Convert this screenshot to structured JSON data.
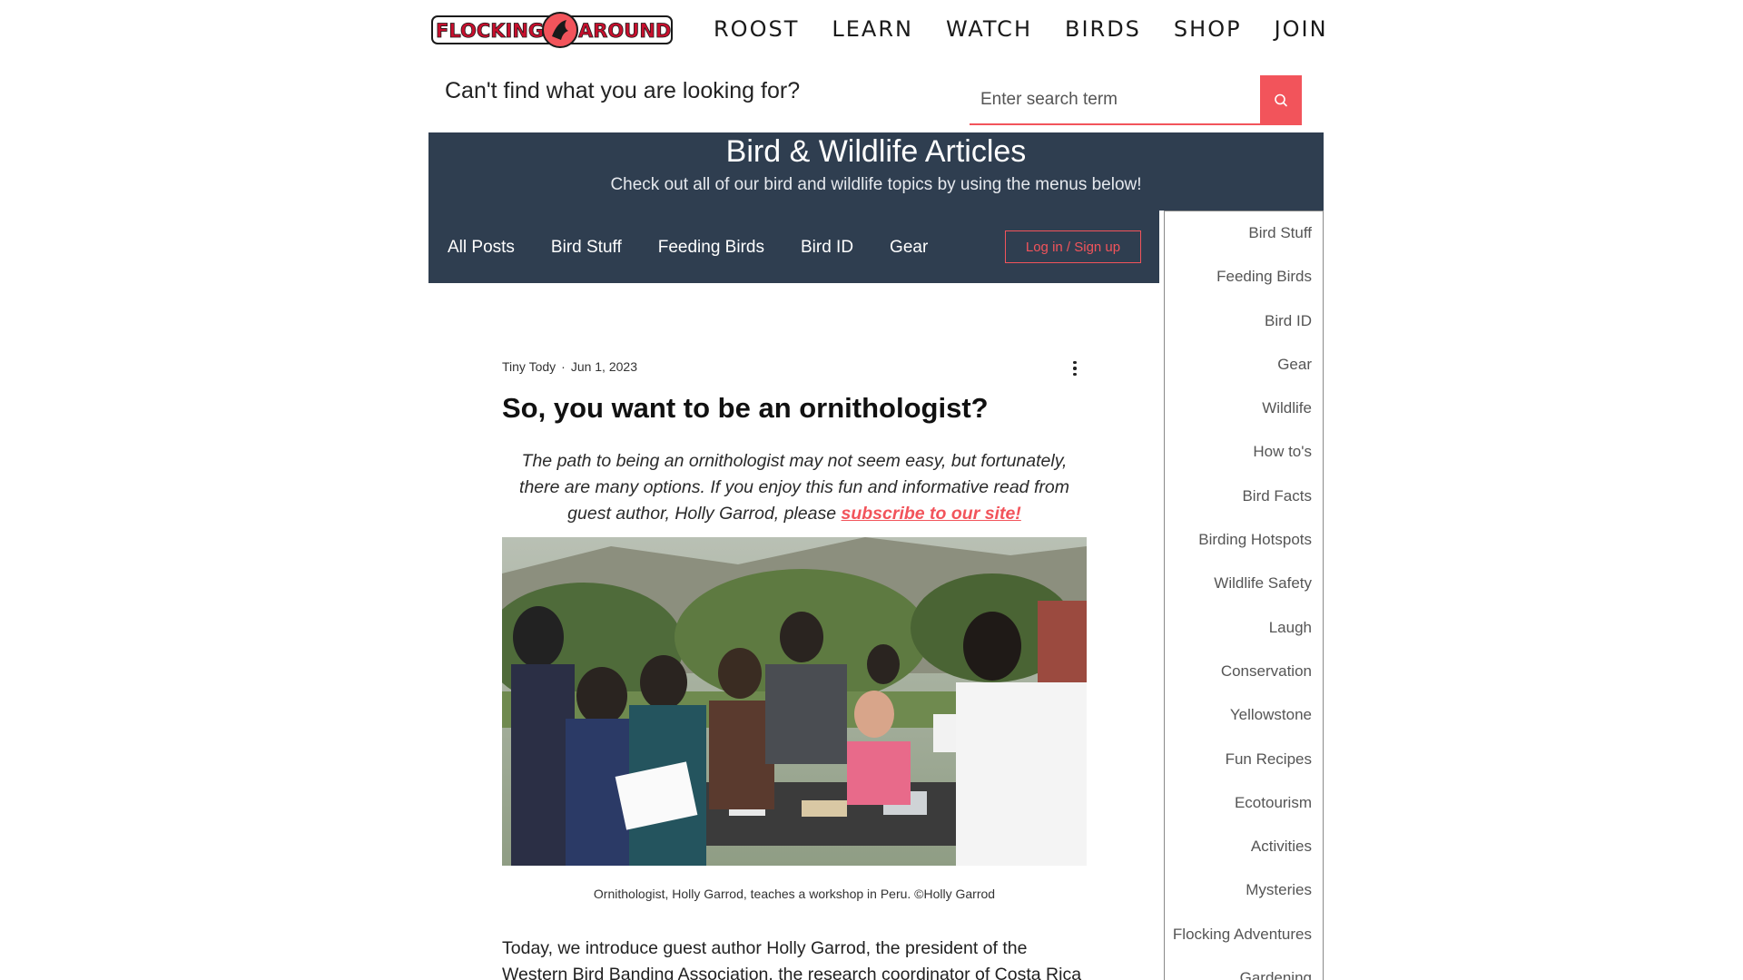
{
  "brand": {
    "logo_text_left": "FLOCKING",
    "logo_text_right": "AROUND",
    "accent_color": "#f2545b",
    "navy_color": "#2f3e50"
  },
  "topnav": [
    "ROOST",
    "LEARN",
    "WATCH",
    "BIRDS",
    "SHOP",
    "JOIN"
  ],
  "search": {
    "prompt": "Can't find what you are looking for?",
    "placeholder": "Enter search term"
  },
  "hero": {
    "title": "Bird & Wildlife Articles",
    "subtitle": "Check out all of our bird and wildlife topics by using the menus below!"
  },
  "blognav": {
    "links": [
      "All Posts",
      "Bird Stuff",
      "Feeding Birds",
      "Bird ID",
      "Gear"
    ],
    "login_label": "Log in / Sign up"
  },
  "sidebar": {
    "items": [
      "Bird Stuff",
      "Feeding Birds",
      "Bird ID",
      "Gear",
      "Wildlife",
      "How to's",
      "Bird Facts",
      "Birding Hotspots",
      "Wildlife Safety",
      "Laugh",
      "Conservation",
      "Yellowstone",
      "Fun Recipes",
      "Ecotourism",
      "Activities",
      "Mysteries",
      "Flocking Adventures",
      "Gardening"
    ]
  },
  "post": {
    "author": "Tiny Tody",
    "separator": "·",
    "date": "Jun 1, 2023",
    "title": "So, you want to be an ornithologist?",
    "intro": "The path to being an ornithologist may not seem easy, but fortunately, there are many options. If you enjoy this fun and informative read from guest author, Holly Garrod, please ",
    "intro_link": "subscribe to our site!",
    "caption": "Ornithologist, Holly Garrod, teaches a workshop in Peru. ©Holly Garrod",
    "body": "Today, we introduce guest author Holly Garrod, the president of the Western Bird Banding Association, the research coordinator of Costa Rica"
  },
  "icons": {
    "search": "search-icon",
    "more": "more-vertical-icon"
  }
}
